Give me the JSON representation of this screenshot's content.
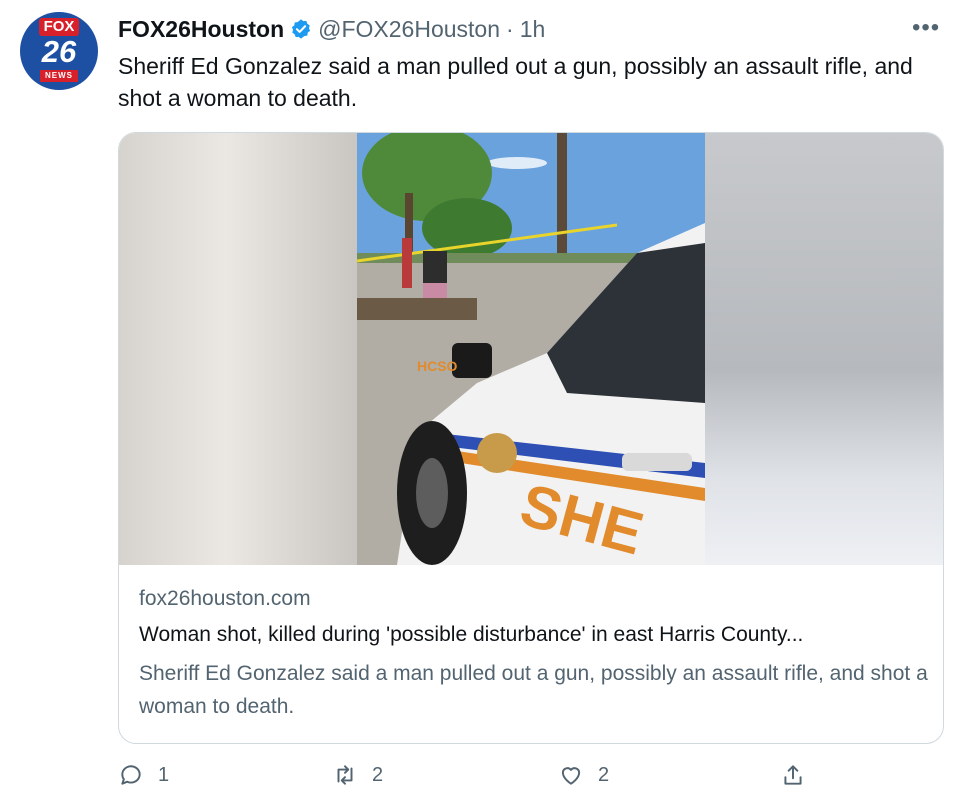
{
  "avatar": {
    "top_label": "FOX",
    "number": "26",
    "bottom_label": "NEWS"
  },
  "header": {
    "name": "FOX26Houston",
    "handle": "@FOX26Houston",
    "separator": "·",
    "time": "1h",
    "more": "•••"
  },
  "tweet": {
    "text": "Sheriff Ed Gonzalez said a man pulled out a gun, possibly an assault rifle, and shot a woman to death."
  },
  "card": {
    "domain": "fox26houston.com",
    "title": "Woman shot, killed during 'possible disturbance' in east Harris County...",
    "description": "Sheriff Ed Gonzalez said a man pulled out a gun, possibly an assault rifle, and shot a woman to death.",
    "vehicle_text": "HCSO"
  },
  "actions": {
    "reply_count": "1",
    "retweet_count": "2",
    "like_count": "2"
  },
  "colors": {
    "verified": "#1d9bf0",
    "text": "#0f1419",
    "secondary": "#536471",
    "border": "#cfd9de"
  },
  "icons": [
    "verified-icon",
    "more-icon",
    "reply-icon",
    "retweet-icon",
    "like-icon",
    "share-icon"
  ]
}
